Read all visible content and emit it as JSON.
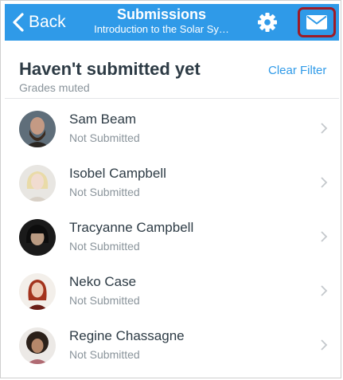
{
  "nav": {
    "back_label": "Back",
    "title": "Submissions",
    "subtitle": "Introduction to the Solar Sy…",
    "settings_icon": "gear-icon",
    "message_icon": "envelope-icon",
    "highlight_color": "#9e1b26",
    "bar_color": "#2f9ae8"
  },
  "filter": {
    "heading": "Haven't submitted yet",
    "subheading": "Grades muted",
    "clear_label": "Clear Filter"
  },
  "students": [
    {
      "name": "Sam Beam",
      "status": "Not Submitted"
    },
    {
      "name": "Isobel Campbell",
      "status": "Not Submitted"
    },
    {
      "name": "Tracyanne Campbell",
      "status": "Not Submitted"
    },
    {
      "name": "Neko Case",
      "status": "Not Submitted"
    },
    {
      "name": "Regine Chassagne",
      "status": "Not Submitted"
    }
  ]
}
